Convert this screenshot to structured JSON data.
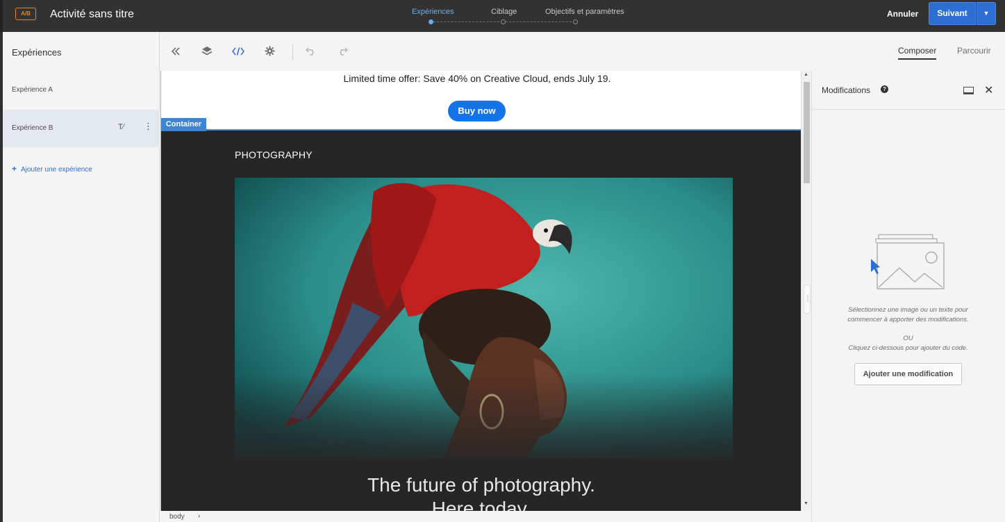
{
  "header": {
    "badge": "A/B",
    "title": "Activité sans titre",
    "steps": [
      {
        "label": "Expériences",
        "active": true
      },
      {
        "label": "Ciblage",
        "active": false
      },
      {
        "label": "Objectifs et paramètres",
        "active": false
      }
    ],
    "cancel_label": "Annuler",
    "next_label": "Suivant"
  },
  "left_panel": {
    "title": "Expériences",
    "experiences": [
      {
        "label": "Expérience A",
        "selected": false
      },
      {
        "label": "Expérience B",
        "selected": true
      }
    ],
    "add_label": "Ajouter une expérience"
  },
  "toolbar": {
    "icons": [
      "collapse-icon",
      "layers-icon",
      "code-icon",
      "settings-icon",
      "undo-icon",
      "redo-icon"
    ],
    "view_tabs": [
      {
        "label": "Composer",
        "active": true
      },
      {
        "label": "Parcourir",
        "active": false
      }
    ]
  },
  "canvas": {
    "promo_text": "Limited time offer: Save 40% on Creative Cloud, ends July 19.",
    "buy_label": "Buy now",
    "container_tag": "Container",
    "section_label": "PHOTOGRAPHY",
    "headline_line1": "The future of photography.",
    "headline_line2": "Here today."
  },
  "right_panel": {
    "title": "Modifications",
    "help": "?",
    "message": "Sélectionnez une image ou un texte pour commencer à apporter des modifications.",
    "or": "OU",
    "message2": "Cliquez ci-dessous pour ajouter du code.",
    "add_label": "Ajouter une modification"
  },
  "status_bar": {
    "breadcrumb": "body"
  },
  "colors": {
    "accent": "#2d6ed4",
    "brand_blue": "#1473e6",
    "badge_orange": "#e68619",
    "header_bg": "#323232",
    "canvas_bg": "#262626"
  }
}
